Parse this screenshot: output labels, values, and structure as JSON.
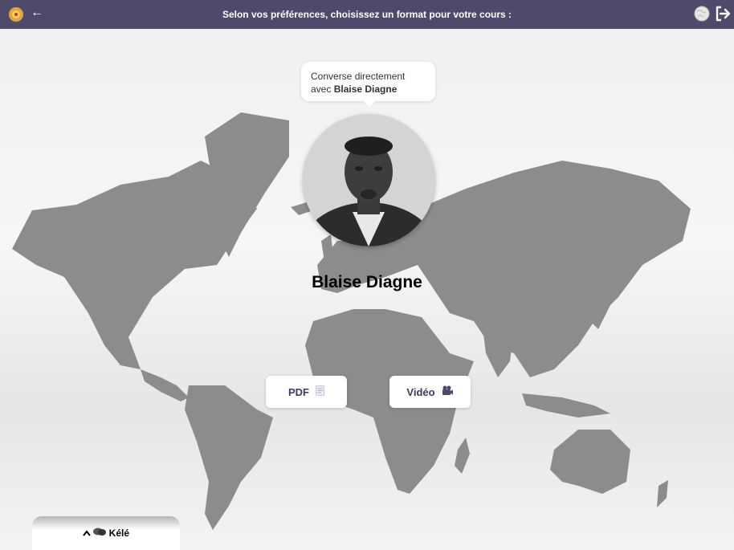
{
  "header": {
    "title": "Selon vos préférences, choisissez un format pour votre cours :",
    "back_glyph": "←",
    "logo_icon": "flower-logo-icon",
    "globe_icon": "globe-icon",
    "logout_icon": "logout-icon"
  },
  "bubble": {
    "line1": "Converse directement",
    "line2_prefix": "avec ",
    "line2_name": "Blaise Diagne"
  },
  "person": {
    "name": "Blaise Diagne"
  },
  "formats": {
    "pdf_label": "PDF",
    "video_label": "Vidéo"
  },
  "kele": {
    "label": "Kélé",
    "chevron_icon": "chevron-up-icon",
    "chat_icon": "chat-bubbles-icon"
  },
  "colors": {
    "header_bg": "#4e4a6b",
    "accent": "#3e3a5a"
  }
}
